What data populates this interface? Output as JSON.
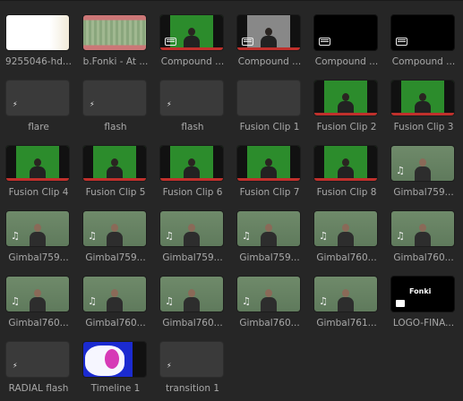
{
  "media_pool": {
    "items": [
      {
        "label": "9255046-hd...",
        "thumb": "white-image"
      },
      {
        "label": "b.Fonki - At ...",
        "thumb": "audio-waveform"
      },
      {
        "label": "Compound ...",
        "thumb": "green-screen-person",
        "icon": "compound-clip-icon"
      },
      {
        "label": "Compound ...",
        "thumb": "bw-person",
        "icon": "compound-clip-icon"
      },
      {
        "label": "Compound ...",
        "thumb": "black",
        "icon": "compound-clip-icon"
      },
      {
        "label": "Compound ...",
        "thumb": "black",
        "icon": "compound-clip-icon"
      },
      {
        "label": "flare",
        "thumb": "empty",
        "icon": "fusion-icon"
      },
      {
        "label": "flash",
        "thumb": "empty",
        "icon": "fusion-icon"
      },
      {
        "label": "flash",
        "thumb": "empty",
        "icon": "fusion-icon"
      },
      {
        "label": "Fusion Clip 1",
        "thumb": "empty"
      },
      {
        "label": "Fusion Clip 2",
        "thumb": "green-screen-person"
      },
      {
        "label": "Fusion Clip 3",
        "thumb": "green-screen-person"
      },
      {
        "label": "Fusion Clip 4",
        "thumb": "green-screen-person"
      },
      {
        "label": "Fusion Clip 5",
        "thumb": "green-screen-person"
      },
      {
        "label": "Fusion Clip 6",
        "thumb": "green-screen-person"
      },
      {
        "label": "Fusion Clip 7",
        "thumb": "green-screen-person"
      },
      {
        "label": "Fusion Clip 8",
        "thumb": "green-screen-person"
      },
      {
        "label": "Gimbal759...",
        "thumb": "studio-person",
        "icon": "music-note-icon"
      },
      {
        "label": "Gimbal759...",
        "thumb": "studio-person",
        "icon": "music-note-icon"
      },
      {
        "label": "Gimbal759...",
        "thumb": "studio-person",
        "icon": "music-note-icon"
      },
      {
        "label": "Gimbal759...",
        "thumb": "studio-person",
        "icon": "music-note-icon"
      },
      {
        "label": "Gimbal759...",
        "thumb": "studio-person",
        "icon": "music-note-icon"
      },
      {
        "label": "Gimbal760...",
        "thumb": "studio-person",
        "icon": "music-note-icon"
      },
      {
        "label": "Gimbal760...",
        "thumb": "studio-person",
        "icon": "music-note-icon"
      },
      {
        "label": "Gimbal760...",
        "thumb": "studio-person",
        "icon": "music-note-icon"
      },
      {
        "label": "Gimbal760...",
        "thumb": "studio-person",
        "icon": "music-note-icon"
      },
      {
        "label": "Gimbal760...",
        "thumb": "studio-person",
        "icon": "music-note-icon"
      },
      {
        "label": "Gimbal760...",
        "thumb": "studio-person",
        "icon": "music-note-icon"
      },
      {
        "label": "Gimbal761...",
        "thumb": "studio-person",
        "icon": "music-note-icon"
      },
      {
        "label": "LOGO-FINA...",
        "thumb": "logo",
        "icon": "image-icon",
        "logo_text": "Fonki"
      },
      {
        "label": "RADIAL flash",
        "thumb": "empty",
        "icon": "fusion-icon"
      },
      {
        "label": "Timeline 1",
        "thumb": "timeline"
      },
      {
        "label": "transition 1",
        "thumb": "empty",
        "icon": "fusion-icon"
      }
    ]
  }
}
